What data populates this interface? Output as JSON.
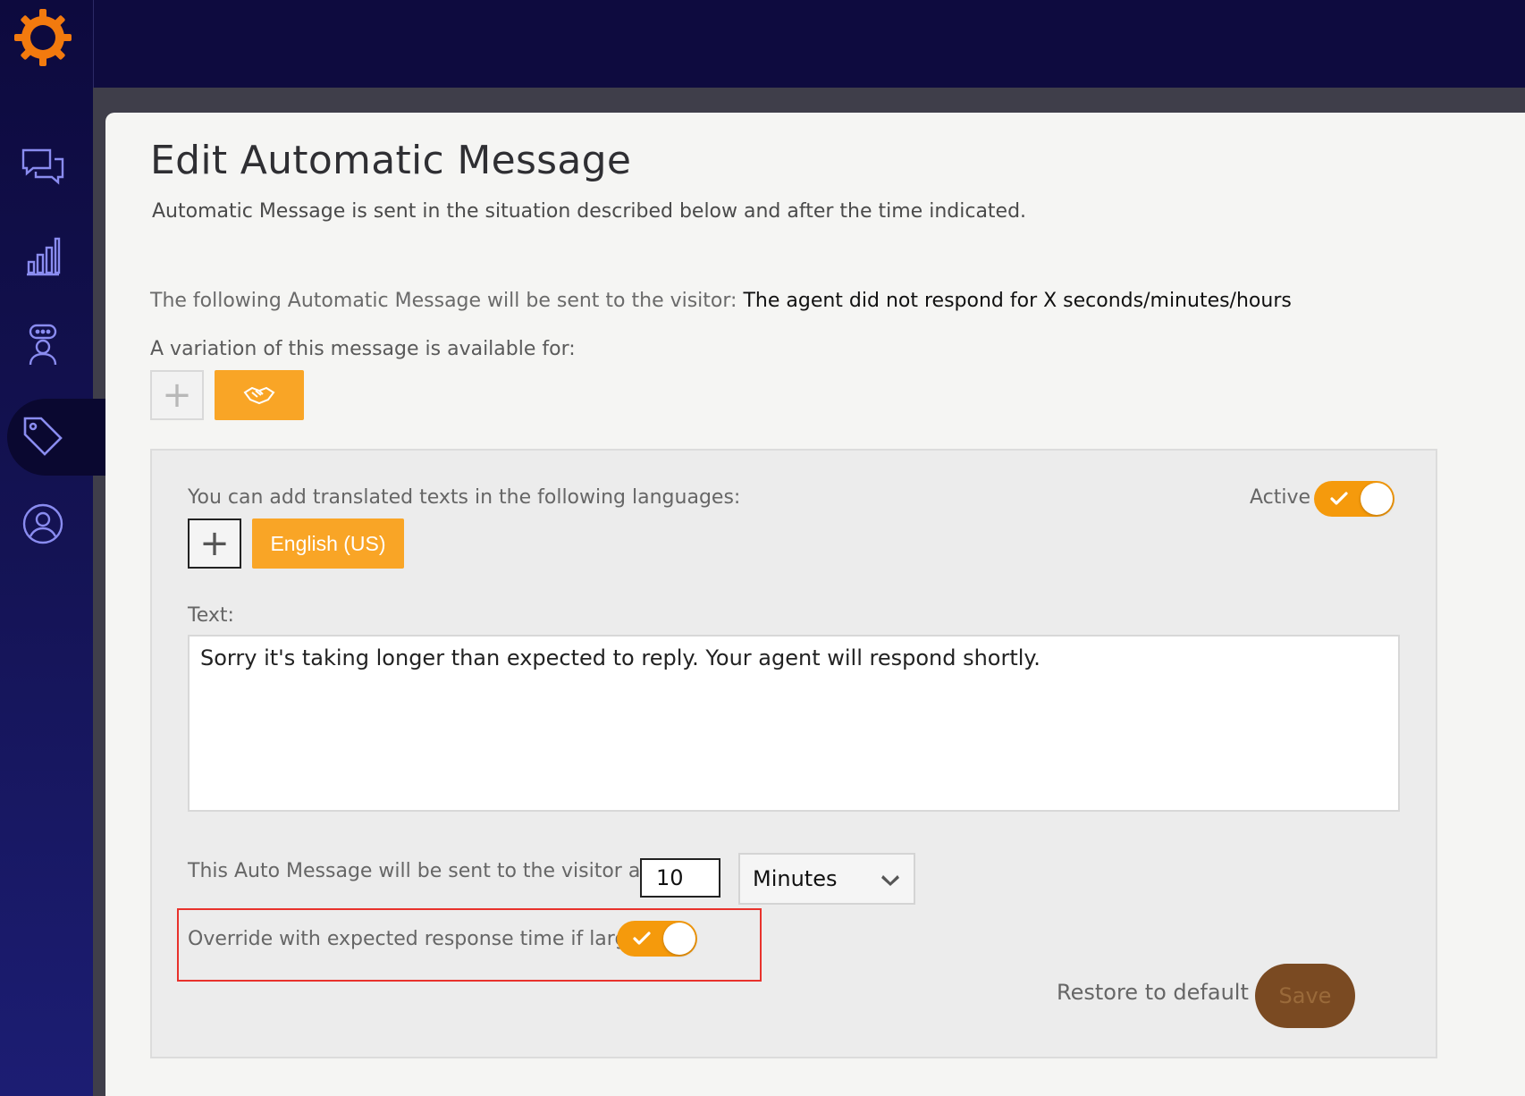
{
  "nav": {
    "items": [
      "chat-icon",
      "analytics-icon",
      "agent-icon",
      "tag-icon",
      "user-icon"
    ],
    "active": "tag-icon"
  },
  "page": {
    "title": "Edit Automatic Message",
    "subtitle": "Automatic Message is sent in the situation described below and after the time indicated.",
    "sent_prefix": "The following Automatic Message will be sent to the visitor:",
    "sent_value": "The agent did not respond for X seconds/minutes/hours",
    "variation_label": "A variation of this message is available for:",
    "add_symbol": "+"
  },
  "form": {
    "languages_label": "You can add translated texts in the following languages:",
    "active_label": "Active",
    "active_on": true,
    "language_button": "English (US)",
    "text_label": "Text:",
    "text_value": "Sorry it's taking longer than expected to reply. Your agent will respond shortly.",
    "after_label": "This Auto Message will be sent to the visitor after",
    "after_value": "10",
    "unit_value": "Minutes",
    "override_label": "Override with expected response time if larger",
    "override_on": true,
    "restore_label": "Restore to default",
    "save_label": "Save"
  },
  "colors": {
    "accent": "#f9a526",
    "toggle": "#f59a0c",
    "highlight": "#e8322c",
    "save": "#7a4a22"
  }
}
